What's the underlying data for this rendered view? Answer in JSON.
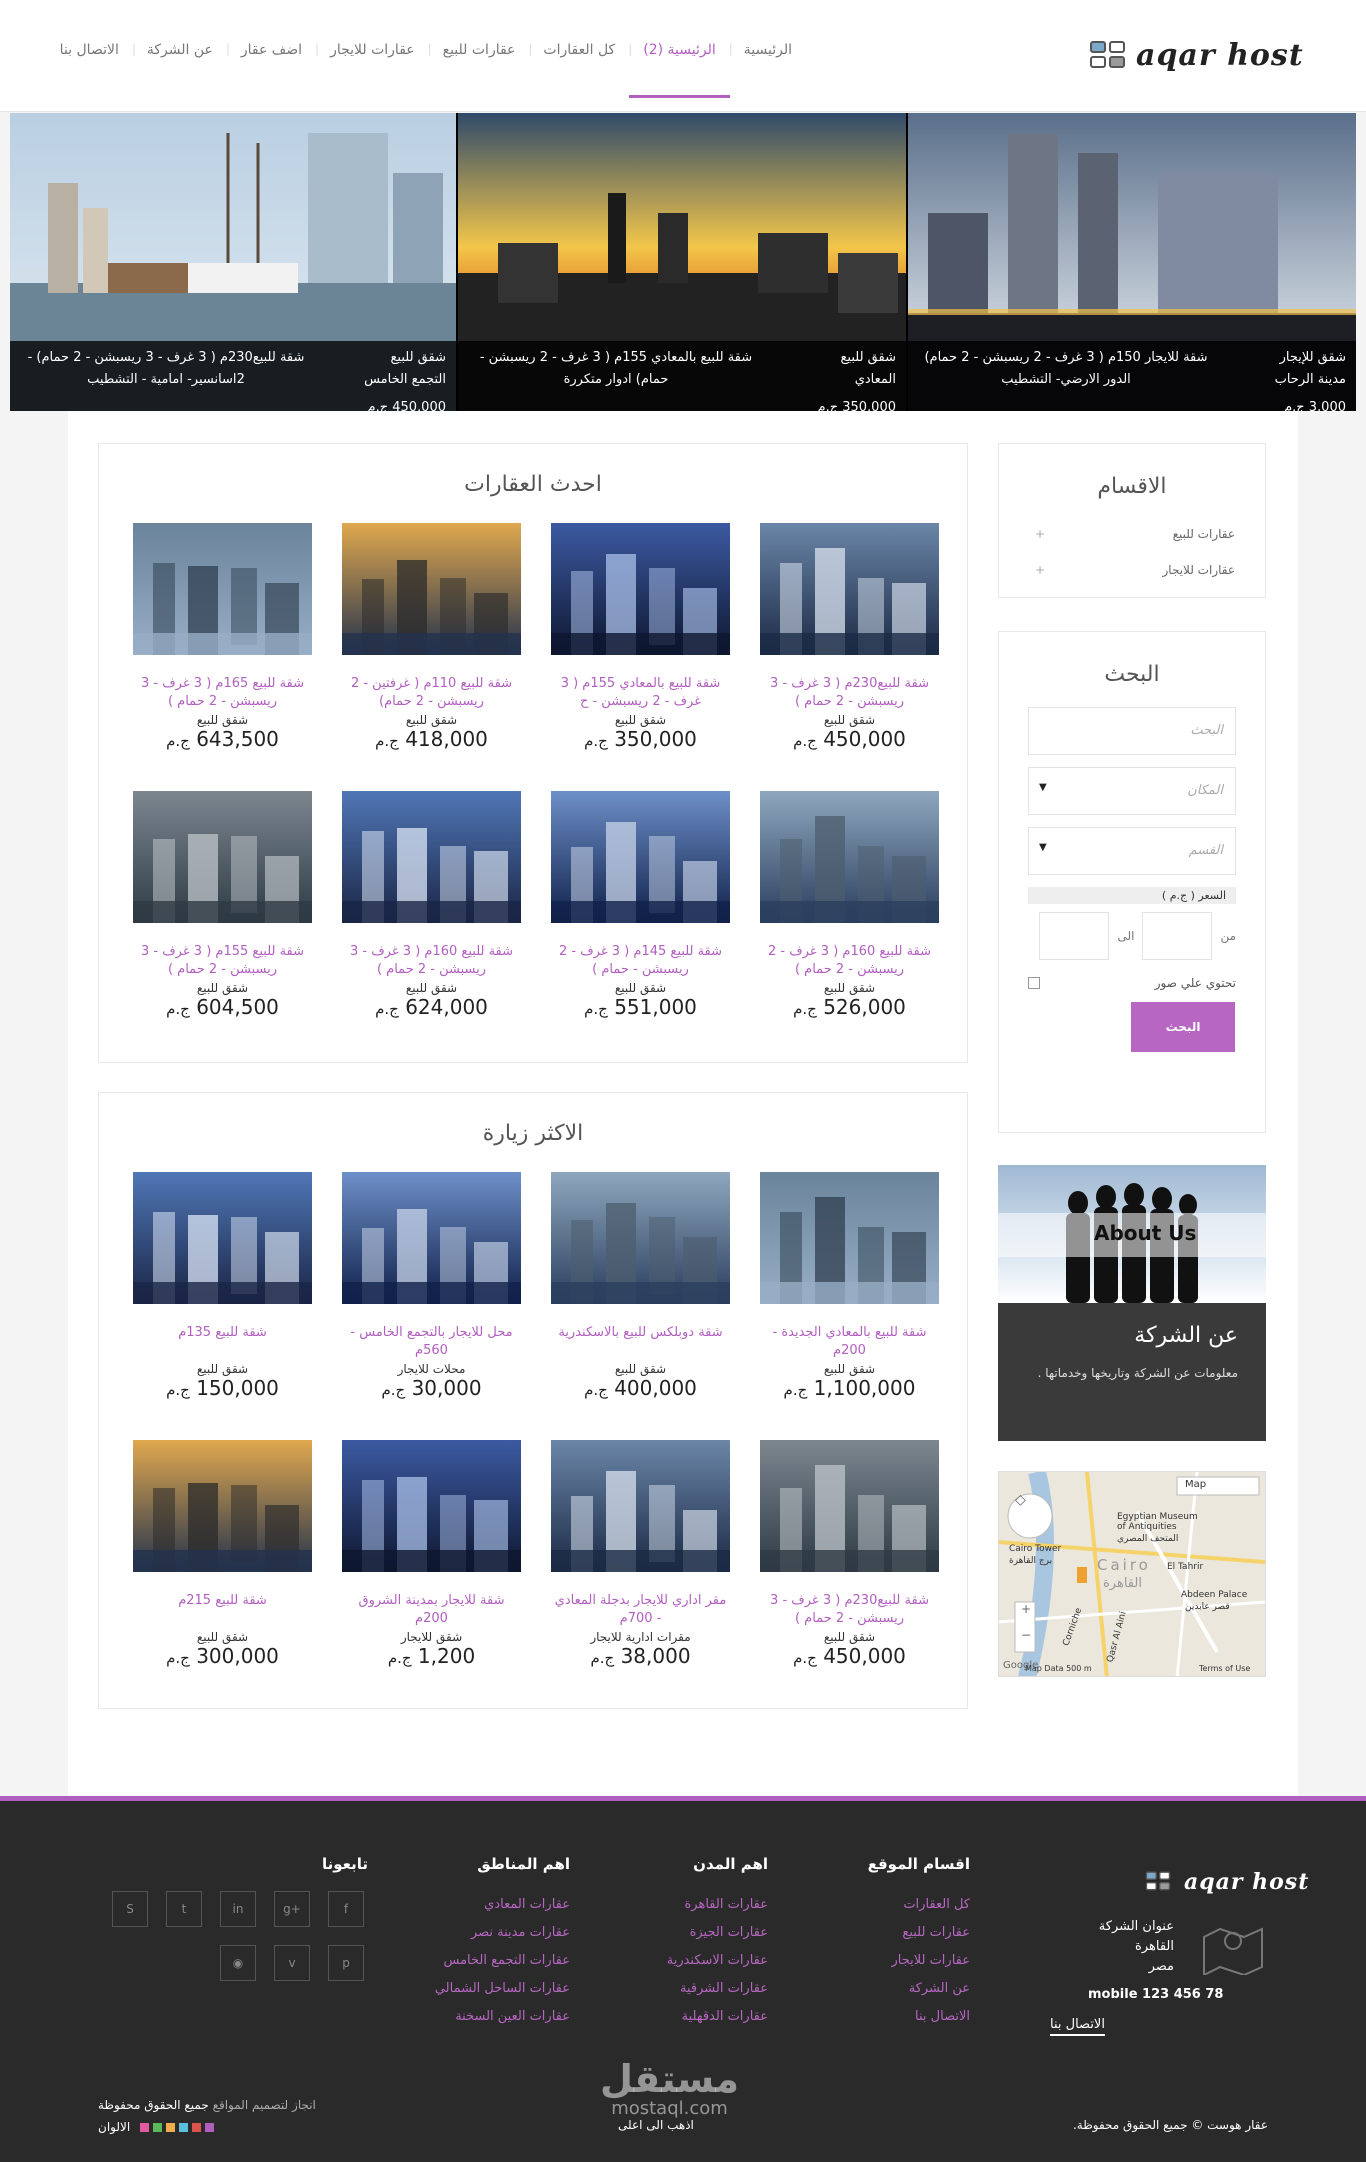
{
  "header": {
    "logo_text": "aqar host",
    "nav": [
      {
        "label": "الرئيسية"
      },
      {
        "label": "الرئيسية (2)",
        "active": true
      },
      {
        "label": "كل العقارات"
      },
      {
        "label": "عقارات للبيع"
      },
      {
        "label": "عقارات للايجار"
      },
      {
        "label": "اضف عقار"
      },
      {
        "label": "عن الشركة"
      },
      {
        "label": "الاتصال بنا"
      }
    ]
  },
  "slider": [
    {
      "type": "شقق للإيجار",
      "location": "مدينة الرحاب",
      "price": "3,000 ج.م",
      "title": "شقة للايجار 150م ( 3 غرف - 2 ريسبشن - 2 حمام) الدور الارضي- التشطيب"
    },
    {
      "type": "شقق للبيع",
      "location": "المعادي",
      "price": "350,000 ج.م",
      "title": "شقة للبيع بالمعادي 155م ( 3 غرف - 2 ريسبشن - حمام) ادوار متكررة"
    },
    {
      "type": "شقق للبيع",
      "location": "التجمع الخامس",
      "price": "450,000 ج.م",
      "title": "شقة للبيع230م ( 3 غرف - 3 ريسبشن - 2 حمام) - 2اسانسير- امامية - التشطيب"
    }
  ],
  "latest": {
    "title": "احدث العقارات",
    "items": [
      {
        "title": "شقة للبيع230م ( 3 غرف - 3 ريسبشن - 2 حمام )",
        "type": "شقق للبيع",
        "price": "450,000",
        "currency": "ج.م"
      },
      {
        "title": "شقة للبيع بالمعادي 155م ( 3 غرف - 2 ريسبشن - ح",
        "type": "شقق للبيع",
        "price": "350,000",
        "currency": "ج.م"
      },
      {
        "title": "شقة للبيع 110م ( غرفتين - 2 ريسبشن - 2 حمام)",
        "type": "شقق للبيع",
        "price": "418,000",
        "currency": "ج.م"
      },
      {
        "title": "شقة للبيع 165م ( 3 غرف - 3 ريسبشن - 2 حمام )",
        "type": "شقق للبيع",
        "price": "643,500",
        "currency": "ج.م"
      },
      {
        "title": "شقة للبيع 160م ( 3 غرف - 2 ريسبشن - 2 حمام )",
        "type": "شقق للبيع",
        "price": "526,000",
        "currency": "ج.م"
      },
      {
        "title": "شقة للبيع 145م ( 3 غرف - 2 ريسبشن - حمام )",
        "type": "شقق للبيع",
        "price": "551,000",
        "currency": "ج.م"
      },
      {
        "title": "شقة للبيع 160م ( 3 غرف - 3 ريسبشن - 2 حمام )",
        "type": "شقق للبيع",
        "price": "624,000",
        "currency": "ج.م"
      },
      {
        "title": "شقة للبيع 155م ( 3 غرف - 3 ريسبشن - 2 حمام )",
        "type": "شقق للبيع",
        "price": "604,500",
        "currency": "ج.م"
      }
    ]
  },
  "popular": {
    "title": "الاكثر زيارة",
    "items": [
      {
        "title": "شقة للبيع بالمعادي الجديدة - 200م",
        "type": "شقق للبيع",
        "price": "1,100,000",
        "currency": "ج.م"
      },
      {
        "title": "شقة دوبلكس للبيع بالاسكندرية",
        "type": "شقق للبيع",
        "price": "400,000",
        "currency": "ج.م"
      },
      {
        "title": "محل للايجار بالتجمع الخامس - 560م",
        "type": "محلات للايجار",
        "price": "30,000",
        "currency": "ج.م"
      },
      {
        "title": "شقة للبيع 135م",
        "type": "شقق للبيع",
        "price": "150,000",
        "currency": "ج.م"
      },
      {
        "title": "شقة للبيع230م ( 3 غرف - 3 ريسبشن - 2 حمام )",
        "type": "شقق للبيع",
        "price": "450,000",
        "currency": "ج.م"
      },
      {
        "title": "مقر اداري للايجار بدجلة المعادي - 700م",
        "type": "مقرات ادارية للايجار",
        "price": "38,000",
        "currency": "ج.م"
      },
      {
        "title": "شقة للايجار بمدينة الشروق 200م",
        "type": "شقق للايجار",
        "price": "1,200",
        "currency": "ج.م"
      },
      {
        "title": "شقة للبيع 215م",
        "type": "شقق للبيع",
        "price": "300,000",
        "currency": "ج.م"
      }
    ]
  },
  "sidebar": {
    "categories_title": "الاقسام",
    "categories": [
      "عقارات للبيع",
      "عقارات للايجار"
    ],
    "search_title": "البحث",
    "search_placeholder": "البحث",
    "location_placeholder": "المكان",
    "category_placeholder": "القسم",
    "price_label": "السعر ( ج.م )",
    "from_label": "من",
    "to_label": "الى",
    "images_label": "تحتوي علي صور",
    "search_button": "البحث",
    "about_banner": "About Us",
    "about_title": "عن الشركة",
    "about_text": "معلومات عن الشركة وتاريخها وخدماتها .",
    "map": {
      "type_label": "Map",
      "label_museum": "Egyptian Museum of Antiquities",
      "label_museum_ar": "المتحف المصري",
      "label_tower": "Cairo Tower",
      "label_tower_ar": "برج القاهرة",
      "label_cairo": "Cairo",
      "label_cairo_ar": "القاهرة",
      "label_tahrir": "El Tahrir",
      "label_abdeen": "Abdeen Palace",
      "label_abdeen_ar": "قصر عابدين",
      "label_corniche": "Corniche",
      "label_qasr": "Qasr Al Aini",
      "footer": "Map Data   500 m",
      "terms": "Terms of Use",
      "google": "Google"
    }
  },
  "footer": {
    "logo_text": "aqar host",
    "address_label": "عنوان الشركة",
    "city": "القاهرة",
    "country": "مصر",
    "mobile": "mobile 123 456 78",
    "contact": "الاتصال بنا",
    "cols": [
      {
        "title": "اقسام الموقع",
        "links": [
          "كل العقارات",
          "عقارات للبيع",
          "عقارات للايجار",
          "عن الشركة",
          "الاتصال بنا"
        ]
      },
      {
        "title": "اهم المدن",
        "links": [
          "عقارات القاهرة",
          "عقارات الجيزة",
          "عقارات الاسكندرية",
          "عقارات الشرقية",
          "عقارات الدقهلية"
        ]
      },
      {
        "title": "اهم المناطق",
        "links": [
          "عقارات المعادي",
          "عقارات مدينة نصر",
          "عقارات التجمع الخامس",
          "عقارات الساحل الشمالي",
          "عقارات العين السخنة"
        ]
      }
    ],
    "follow_title": "تابعونا",
    "copyright": "عقار هوست © جميع الحقوق محفوظة.",
    "back_to_top": "اذهب الى اعلى",
    "design_credit": "انجاز لتصميم المواقع",
    "rights": "جميع الحقوق محفوظة",
    "colors_label": "الالوان",
    "swatches": [
      "#b15fbf",
      "#d9534f",
      "#5bc0de",
      "#f0ad4e",
      "#5cb85c",
      "#e25aa0"
    ],
    "watermark": "مستقل",
    "watermark_domain": "mostaql.com"
  }
}
